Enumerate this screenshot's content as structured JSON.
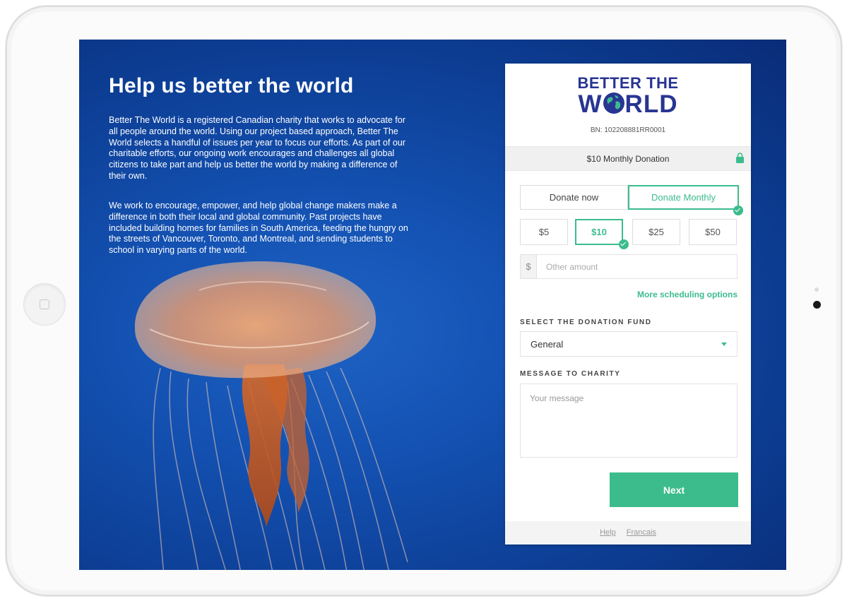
{
  "hero": {
    "title": "Help us better the world",
    "paragraph_1": "Better The World is a registered Canadian charity that works to advocate for all people around the world. Using our project based approach, Better The World selects a handful of issues per year to focus our efforts. As part of our charitable efforts, our ongoing work encourages and challenges all global citizens to take part and help us better the world by making a difference of their own.",
    "paragraph_2": "We work to encourage, empower, and help global change makers make a difference in both their local and global community. Past projects have included building homes for families in South America, feeding the hungry on the streets of Vancouver, Toronto, and Montreal, and sending students to school in varying parts of the world."
  },
  "form": {
    "logo_line1": "BETTER THE",
    "logo_line2_a": "W",
    "logo_line2_b": "RLD",
    "bn": "BN: 102208881RR0001",
    "summary": "$10 Monthly Donation",
    "frequency": {
      "once": "Donate now",
      "monthly": "Donate Monthly",
      "selected": "monthly"
    },
    "amounts": [
      "$5",
      "$10",
      "$25",
      "$50"
    ],
    "selected_amount": "$10",
    "other_prefix": "$",
    "other_placeholder": "Other amount",
    "scheduling_link": "More scheduling options",
    "fund_label": "SELECT THE DONATION FUND",
    "fund_value": "General",
    "message_label": "MESSAGE TO CHARITY",
    "message_placeholder": "Your message",
    "next_label": "Next",
    "footer_help": "Help",
    "footer_lang": "Francais"
  },
  "colors": {
    "accent": "#3cbc8d",
    "brand": "#283593",
    "background": "#1452b3"
  },
  "icons": [
    "lock-icon",
    "check-icon",
    "chevron-down-icon",
    "globe-icon"
  ]
}
